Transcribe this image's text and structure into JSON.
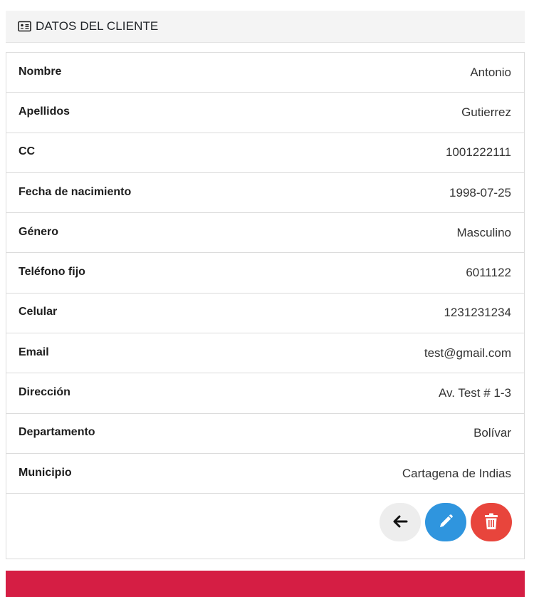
{
  "header": {
    "title": "DATOS DEL CLIENTE",
    "icon": "id-card-icon"
  },
  "client": {
    "rows": [
      {
        "label": "Nombre",
        "value": "Antonio"
      },
      {
        "label": "Apellidos",
        "value": "Gutierrez"
      },
      {
        "label": "CC",
        "value": "1001222111"
      },
      {
        "label": "Fecha de nacimiento",
        "value": "1998-07-25"
      },
      {
        "label": "Género",
        "value": "Masculino"
      },
      {
        "label": "Teléfono fijo",
        "value": "6011122"
      },
      {
        "label": "Celular",
        "value": "1231231234"
      },
      {
        "label": "Email",
        "value": "test@gmail.com"
      },
      {
        "label": "Dirección",
        "value": "Av. Test # 1-3"
      },
      {
        "label": "Departamento",
        "value": "Bolívar"
      },
      {
        "label": "Municipio",
        "value": "Cartagena de Indias"
      }
    ]
  },
  "actions": {
    "back_icon": "arrow-left-icon",
    "edit_icon": "pencil-icon",
    "delete_icon": "trash-icon"
  },
  "colors": {
    "header_bg": "#f4f4f4",
    "edit_button": "#2f95de",
    "delete_button": "#e8453c",
    "back_button": "#ededed",
    "footer_bar": "#d51e44"
  }
}
